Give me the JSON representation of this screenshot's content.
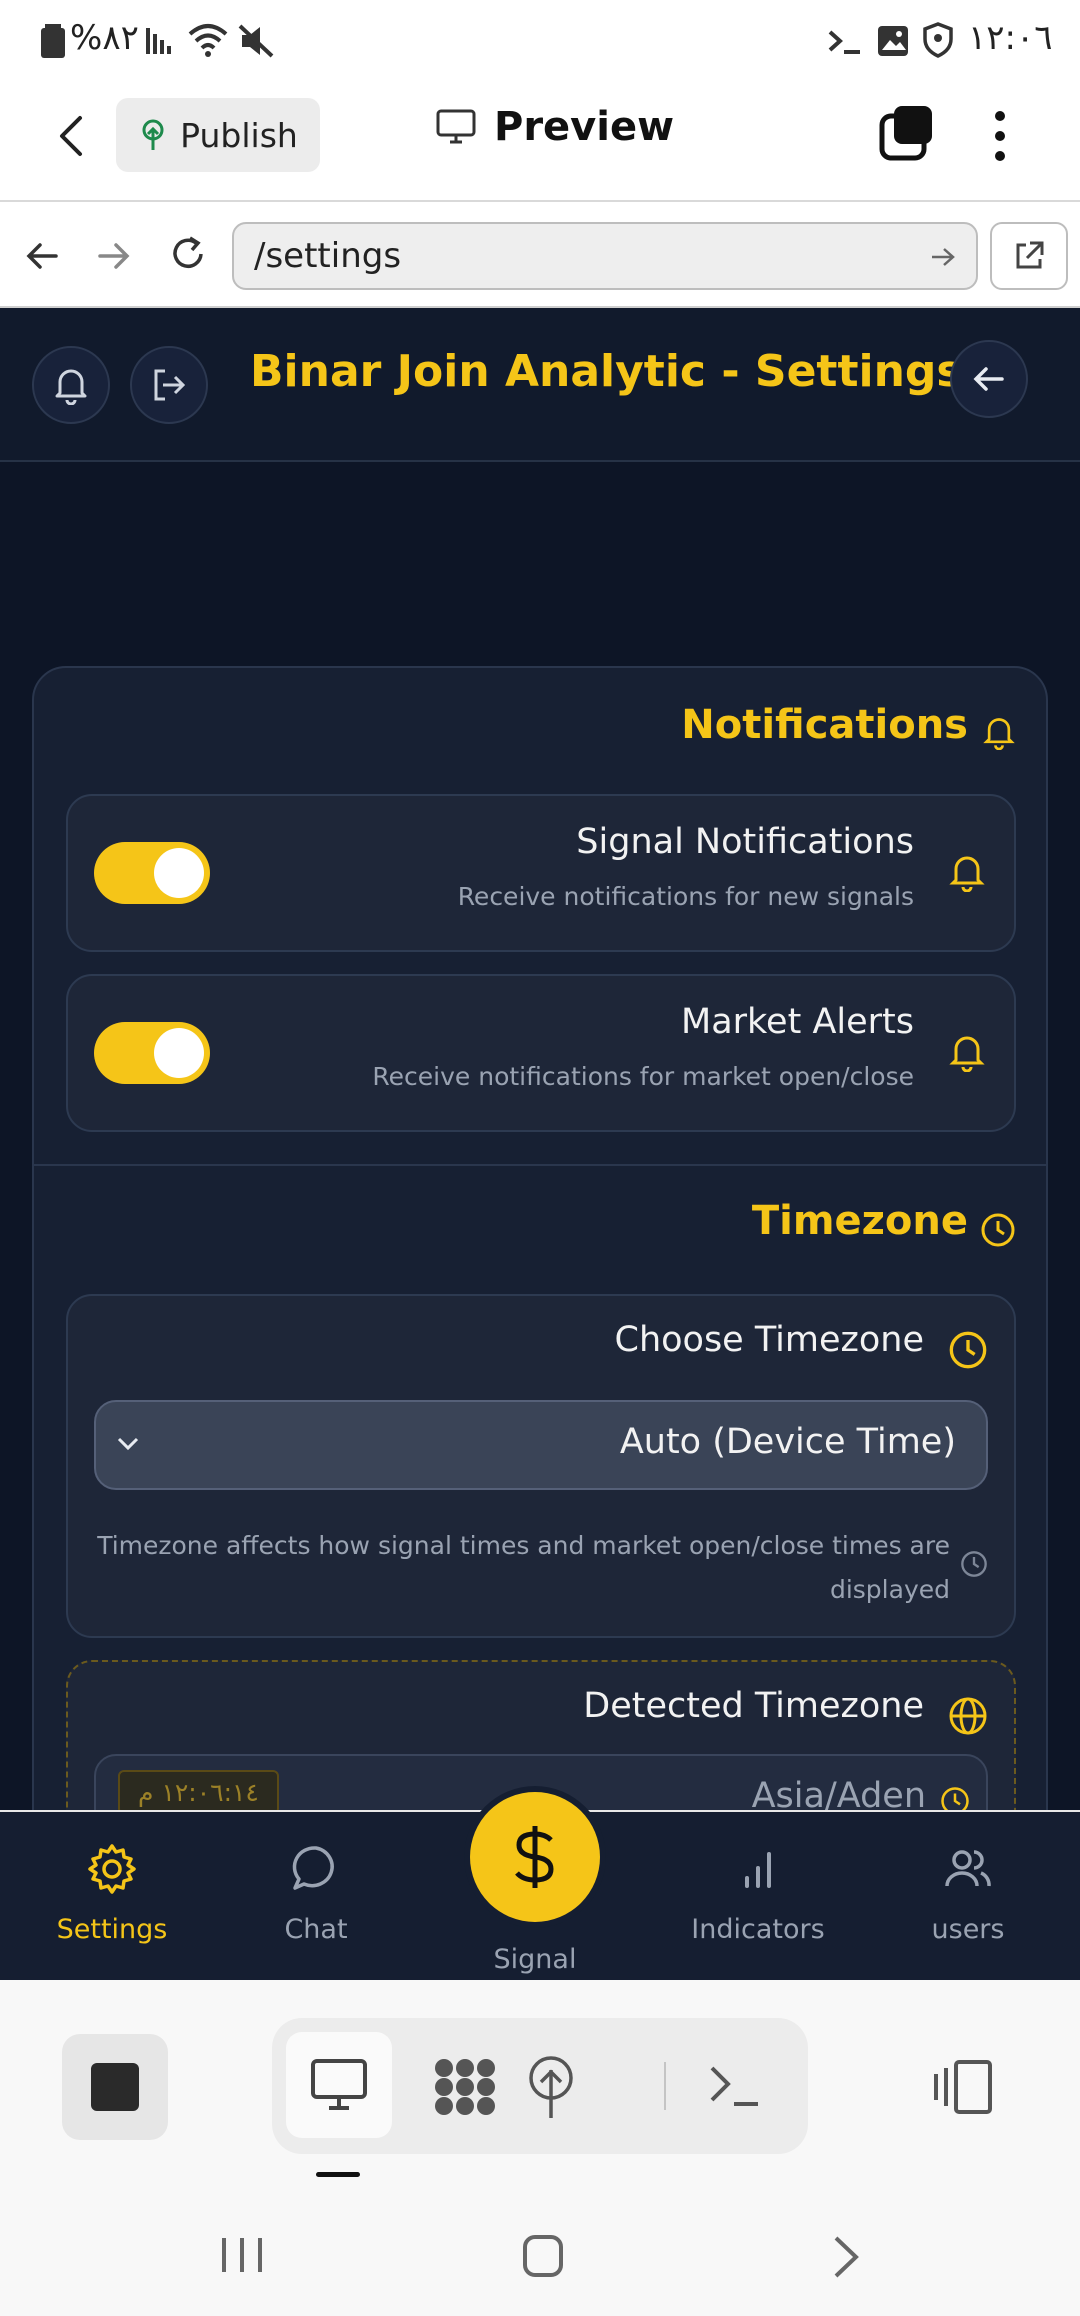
{
  "status_bar": {
    "battery": "%٨٢",
    "time": "١٢:٠٦"
  },
  "app_header": {
    "publish_label": "Publish",
    "preview_label": "Preview"
  },
  "browser": {
    "url": "/settings"
  },
  "app": {
    "title": "Binar Join Analytic - Settings",
    "notifications": {
      "title": "Notifications",
      "items": [
        {
          "title": "Signal Notifications",
          "subtitle": "Receive notifications for new signals",
          "enabled": true
        },
        {
          "title": "Market Alerts",
          "subtitle": "Receive notifications for market open/close",
          "enabled": true
        }
      ]
    },
    "timezone": {
      "title": "Timezone",
      "choose_label": "Choose Timezone",
      "selected": "Auto (Device Time)",
      "hint": "Timezone affects how signal times and market open/close times are displayed",
      "detected_label": "Detected Timezone",
      "detected_value": "Asia/Aden",
      "detected_time": "١٢:٠٦:١٤ م"
    },
    "nav": {
      "settings": "Settings",
      "chat": "Chat",
      "signal": "Signal",
      "indicators": "Indicators",
      "users": "users"
    }
  },
  "colors": {
    "accent": "#f5c518",
    "app_bg": "#0d1526",
    "card_bg": "#172033"
  }
}
